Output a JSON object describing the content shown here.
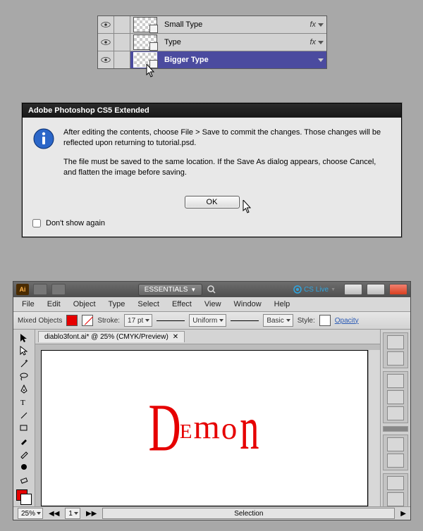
{
  "layers": {
    "rows": [
      {
        "label": "Small Type",
        "fx": "fx",
        "selected": false
      },
      {
        "label": "Type",
        "fx": "fx",
        "selected": false
      },
      {
        "label": "Bigger Type",
        "fx": "",
        "selected": true
      }
    ]
  },
  "psDialog": {
    "title": "Adobe Photoshop CS5 Extended",
    "para1": "After editing the contents, choose File > Save to commit the changes.  Those changes will be reflected upon returning to tutorial.psd.",
    "para2": "The file must be saved to the same location. If the Save As dialog appears, choose Cancel, and flatten the image before saving.",
    "ok": "OK",
    "dontShow": "Don't show again"
  },
  "ai": {
    "logo": "Ai",
    "workspace": "ESSENTIALS",
    "cslive": "CS Live",
    "menus": [
      "File",
      "Edit",
      "Object",
      "Type",
      "Select",
      "Effect",
      "View",
      "Window",
      "Help"
    ],
    "control": {
      "selection": "Mixed Objects",
      "strokeLabel": "Stroke:",
      "strokePt": "17 pt",
      "profile": "Uniform",
      "brush": "Basic",
      "styleLabel": "Style:",
      "opacity": "Opacity"
    },
    "tabTitle": "diablo3font.ai* @ 25% (CMYK/Preview)",
    "artText": "Demon",
    "status": {
      "zoom": "25%",
      "artboardNav": "1",
      "mode": "Selection"
    }
  }
}
